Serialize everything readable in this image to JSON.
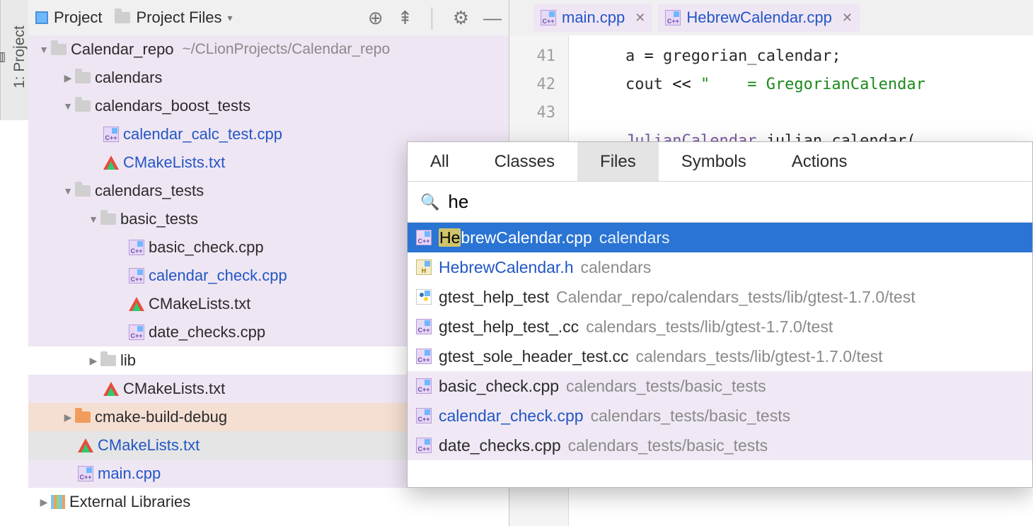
{
  "side_tab": {
    "label": "1: Project"
  },
  "header": {
    "project_label": "Project",
    "scope_label": "Project Files"
  },
  "tree": {
    "root_name": "Calendar_repo",
    "root_path": "~/CLionProjects/Calendar_repo",
    "items": [
      {
        "name": "calendars"
      },
      {
        "name": "calendars_boost_tests"
      },
      {
        "name": "calendar_calc_test.cpp"
      },
      {
        "name": "CMakeLists.txt"
      },
      {
        "name": "calendars_tests"
      },
      {
        "name": "basic_tests"
      },
      {
        "name": "basic_check.cpp"
      },
      {
        "name": "calendar_check.cpp"
      },
      {
        "name": "CMakeLists.txt"
      },
      {
        "name": "date_checks.cpp"
      },
      {
        "name": "lib"
      },
      {
        "name": "CMakeLists.txt"
      },
      {
        "name": "cmake-build-debug"
      },
      {
        "name": "CMakeLists.txt"
      },
      {
        "name": "main.cpp"
      },
      {
        "name": "External Libraries"
      }
    ]
  },
  "editor_tabs": [
    {
      "label": "main.cpp"
    },
    {
      "label": "HebrewCalendar.cpp"
    }
  ],
  "gutter": {
    "l1": "41",
    "l2": "42",
    "l3": "43"
  },
  "code": {
    "l1_a": "a ",
    "l1_b": "=",
    "l1_c": " gregorian_calendar;",
    "l2_a": "cout ",
    "l2_b": "<<",
    "l2_c": " \"    = GregorianCalendar",
    "l4_a": "JulianCalendar",
    "l4_b": " julian_calendar("
  },
  "se": {
    "tabs": {
      "all": "All",
      "classes": "Classes",
      "files": "Files",
      "symbols": "Symbols",
      "actions": "Actions"
    },
    "query": "he",
    "results": [
      {
        "hl": "He",
        "name_rest": "brewCalendar.cpp",
        "loc": "calendars"
      },
      {
        "name": "HebrewCalendar.h",
        "loc": "calendars"
      },
      {
        "name": "gtest_help_test",
        "loc": "Calendar_repo/calendars_tests/lib/gtest-1.7.0/test"
      },
      {
        "name": "gtest_help_test_.cc",
        "loc": "calendars_tests/lib/gtest-1.7.0/test"
      },
      {
        "name": "gtest_sole_header_test.cc",
        "loc": "calendars_tests/lib/gtest-1.7.0/test"
      },
      {
        "name": "basic_check.cpp",
        "loc": "calendars_tests/basic_tests"
      },
      {
        "name": "calendar_check.cpp",
        "loc": "calendars_tests/basic_tests"
      },
      {
        "name": "date_checks.cpp",
        "loc": "calendars_tests/basic_tests"
      }
    ]
  }
}
